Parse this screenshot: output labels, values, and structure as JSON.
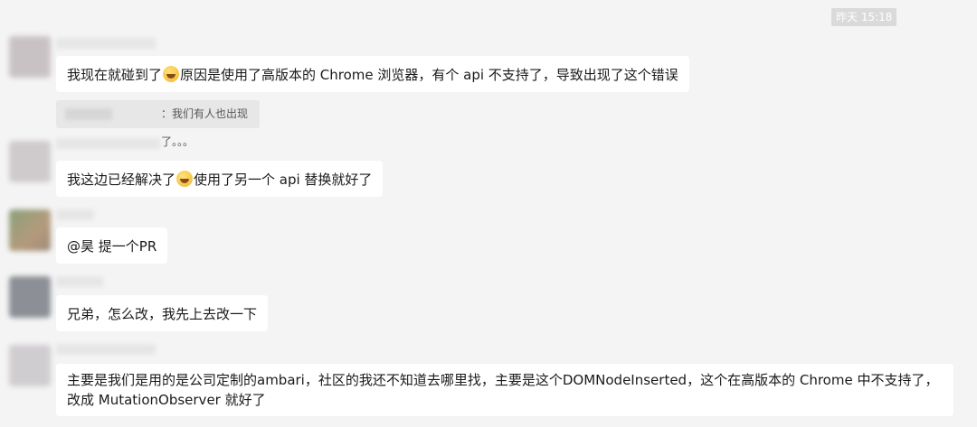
{
  "timestamp": "昨天 15:18",
  "messages": [
    {
      "id": "m1",
      "parts": [
        "我现在就碰到了",
        "原因是使用了高版本的 Chrome 浏览器，有个 api 不支持了，导致出现了这个错误"
      ],
      "emoji": "grin-sweat-icon"
    },
    {
      "id": "m2",
      "parts": [
        "我这边已经解决了",
        "使用了另一个 api 替换就好了"
      ],
      "emoji": "grin-sweat-icon"
    },
    {
      "id": "m3",
      "text": "@昊 提一个PR"
    },
    {
      "id": "m4",
      "text": "兄弟，怎么改，我先上去改一下"
    },
    {
      "id": "m5",
      "text": "主要是我们是用的是公司定制的ambari，社区的我还不知道去哪里找，主要是这个DOMNodeInserted，这个在高版本的 Chrome 中不支持了，改成 MutationObserver 就好了"
    }
  ],
  "quote": {
    "text": "：我们有人也出现了。。。"
  },
  "colors": {
    "background": "#f4f4f4",
    "bubble": "#ffffff",
    "quote": "#e7e7e7",
    "timestamp_bg": "#dadada"
  }
}
